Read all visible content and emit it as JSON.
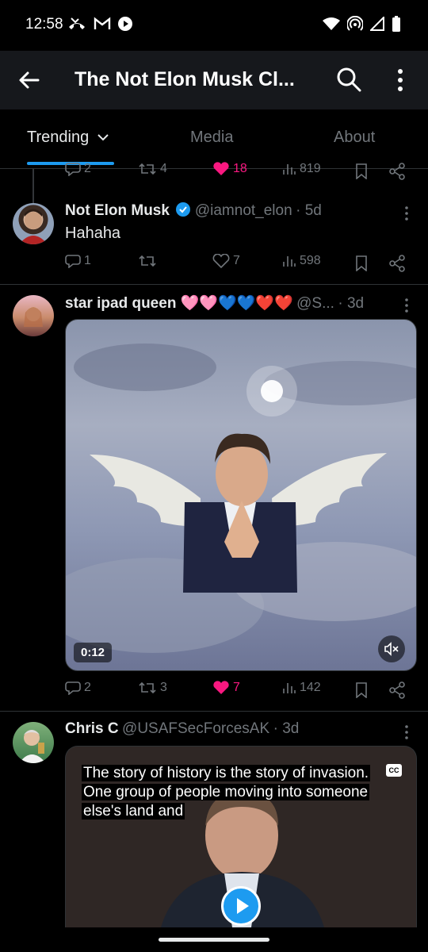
{
  "status_bar": {
    "time": "12:58",
    "left_icons": [
      "missed-call-icon",
      "gmail-icon",
      "play-circle-icon"
    ],
    "right_icons": [
      "wifi-icon",
      "hotspot-icon",
      "signal-icon",
      "battery-icon"
    ]
  },
  "app_bar": {
    "title": "The Not Elon Musk Cl...",
    "back_icon": "arrow-left-icon",
    "search_icon": "search-icon",
    "more_icon": "more-vertical-icon"
  },
  "tabs": [
    {
      "label": "Trending",
      "active": true,
      "has_dropdown": true
    },
    {
      "label": "Media",
      "active": false
    },
    {
      "label": "About",
      "active": false
    }
  ],
  "posts": [
    {
      "id": "prev-post-stats",
      "actions": {
        "replies": "2",
        "reposts": "4",
        "likes": "18",
        "views": "819",
        "liked": true
      }
    },
    {
      "id": "not-elon",
      "display_name": "Not Elon Musk",
      "verified": true,
      "handle": "@iamnot_elon",
      "time": "· 5d",
      "text": "Hahaha",
      "actions": {
        "replies": "1",
        "reposts": "",
        "likes": "7",
        "views": "598",
        "liked": false
      }
    },
    {
      "id": "star-ipad",
      "display_name": "star ipad queen 🩷🩷💙💙❤️❤️",
      "handle": "@S...",
      "time": "· 3d",
      "video": {
        "duration": "0:12",
        "muted": true
      },
      "actions": {
        "replies": "2",
        "reposts": "3",
        "likes": "7",
        "views": "142",
        "liked": true
      }
    },
    {
      "id": "chris-c",
      "display_name": "Chris C",
      "handle": "@USAFSecForcesAK",
      "time": "· 3d",
      "video": {
        "caption": "The story of history is the story of invasion. One group of people moving into someone else's land and",
        "cc_label": "CC"
      }
    }
  ],
  "colors": {
    "accent": "#1d9bf0",
    "like": "#f91880",
    "verified": "#1d9bf0",
    "muted_text": "#71767b",
    "divider": "#2f3336"
  }
}
